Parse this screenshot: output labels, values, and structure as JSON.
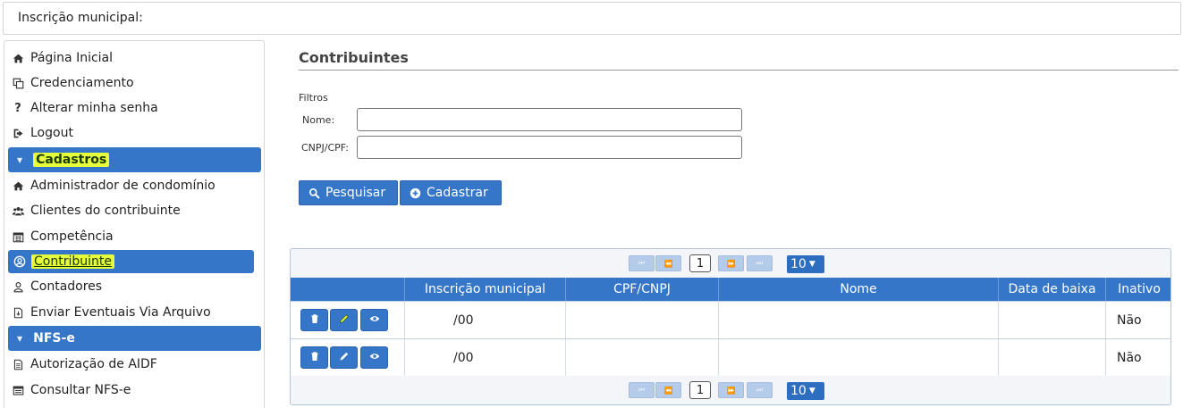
{
  "topbar": {
    "label": "Inscrição municipal:"
  },
  "sidebar": {
    "items": [
      {
        "label": "Página Inicial",
        "icon": "home-icon"
      },
      {
        "label": "Credenciamento",
        "icon": "copy-icon"
      },
      {
        "label": "Alterar minha senha",
        "icon": "question-icon"
      },
      {
        "label": "Logout",
        "icon": "sign-out-icon"
      }
    ],
    "section_cadastros": "Cadastros",
    "cadastros_items": [
      {
        "label": "Administrador de condomínio",
        "icon": "home-icon"
      },
      {
        "label": "Clientes do contribuinte",
        "icon": "users-icon"
      },
      {
        "label": "Competência",
        "icon": "calendar-icon"
      },
      {
        "label": "Contribuinte",
        "icon": "user-circle-icon",
        "active": true
      },
      {
        "label": "Contadores",
        "icon": "user-icon"
      },
      {
        "label": "Enviar Eventuais Via Arquivo",
        "icon": "file-icon"
      }
    ],
    "section_nfse": "NFS-e",
    "nfse_items": [
      {
        "label": "Autorização de AIDF",
        "icon": "file-text-icon"
      },
      {
        "label": "Consultar NFS-e",
        "icon": "list-icon"
      }
    ]
  },
  "main": {
    "title": "Contribuintes",
    "filters_label": "Filtros",
    "nome_label": "Nome:",
    "nome_value": "",
    "cnpj_label": "CNPJ/CPF:",
    "cnpj_value": "",
    "search_button": "Pesquisar",
    "add_button": "Cadastrar"
  },
  "grid": {
    "pager": {
      "current_page": "1",
      "page_size": "10",
      "first": "⏮",
      "prev": "⏪",
      "next": "⏩",
      "last": "⏭"
    },
    "columns": [
      "Inscrição municipal",
      "CPF/CNPJ",
      "Nome",
      "Data de baixa",
      "Inativo"
    ],
    "rows": [
      {
        "inscricao": "/00",
        "cpf_cnpj": "",
        "nome": "",
        "data_baixa": "",
        "inativo": "Não"
      },
      {
        "inscricao": "/00",
        "cpf_cnpj": "",
        "nome": "",
        "data_baixa": "",
        "inativo": "Não"
      }
    ]
  },
  "colors": {
    "accent": "#3576c8",
    "highlight": "#e6ff3b"
  }
}
